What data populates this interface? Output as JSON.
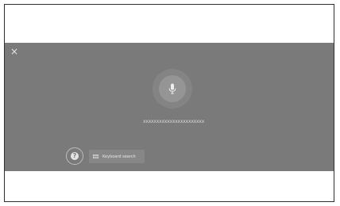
{
  "overlay": {
    "close_glyph": "×",
    "prompt_text": "xxxxxxxxxxxxxxxxxxxxxxx",
    "keyboard_button_label": "Keyboard search",
    "help_glyph": "?"
  },
  "icons": {
    "close": "close-icon",
    "mic": "microphone-icon",
    "help": "help-icon",
    "keyboard": "keyboard-icon"
  },
  "colors": {
    "overlay": "#7a7a7a",
    "mic_halo": "#848484",
    "mic_button": "#959595",
    "text": "#e6e6e6"
  }
}
